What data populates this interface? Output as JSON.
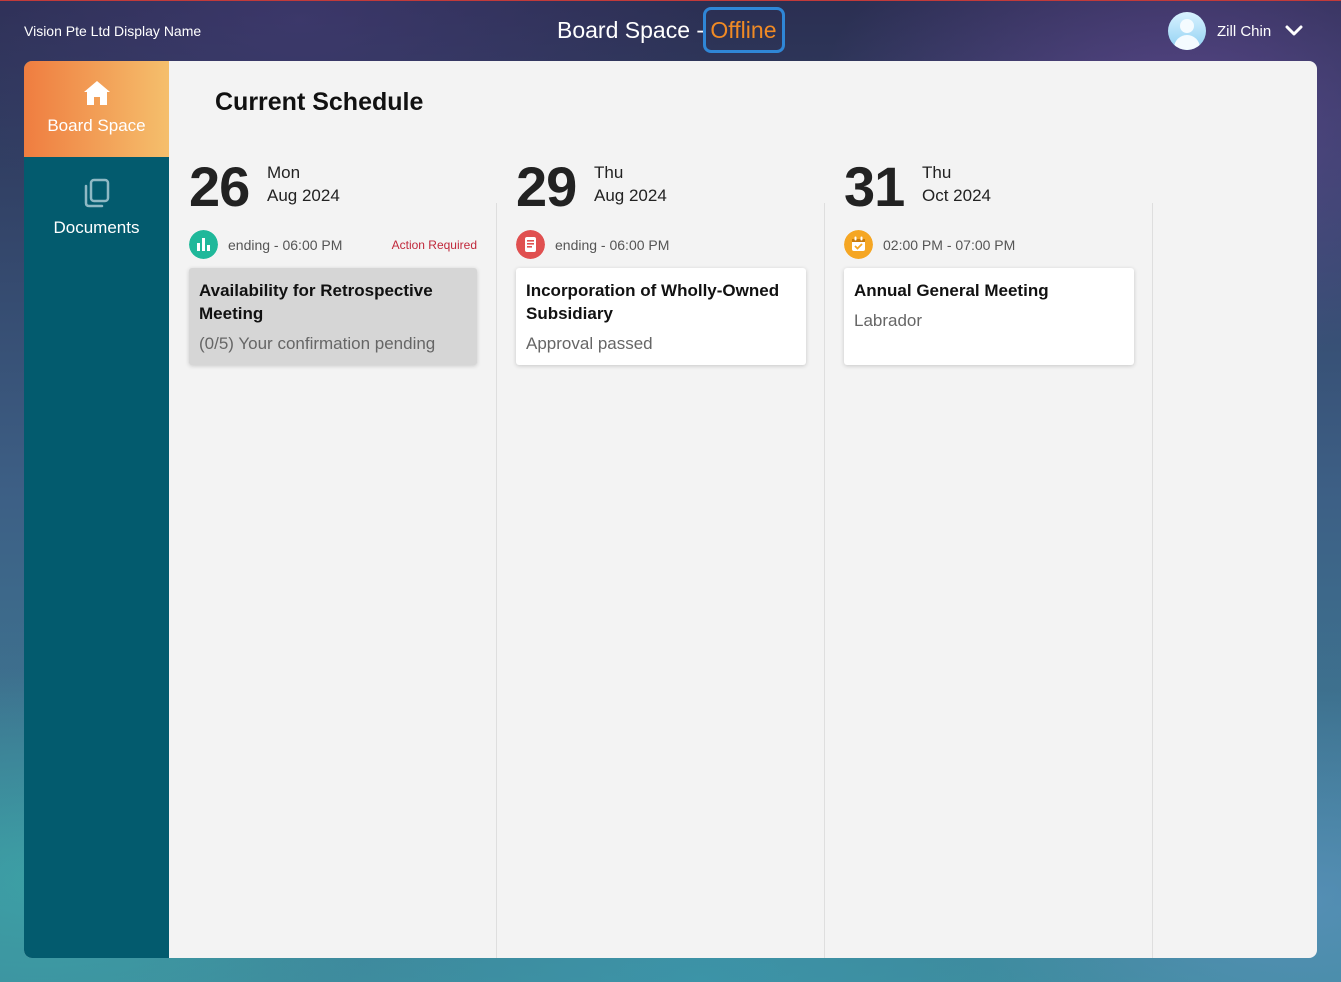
{
  "header": {
    "org_name": "Vision Pte Ltd Display Name",
    "title": "Board Space - ",
    "status": "Offline",
    "user_name": "Zill Chin"
  },
  "sidebar": {
    "items": [
      {
        "label": "Board Space",
        "icon": "home-icon",
        "active": true
      },
      {
        "label": "Documents",
        "icon": "documents-icon",
        "active": false
      }
    ]
  },
  "main": {
    "title": "Current Schedule",
    "columns": [
      {
        "day": "26",
        "weekday": "Mon",
        "month_year": "Aug 2024",
        "time": "ending - 06:00 PM",
        "badge": "Action Required",
        "icon": "poll-icon",
        "icon_color": "#1fb89a",
        "card_title": "Availability for Retrospective Meeting",
        "card_sub": "(0/5) Your confirmation pending"
      },
      {
        "day": "29",
        "weekday": "Thu",
        "month_year": "Aug 2024",
        "time": "ending - 06:00 PM",
        "badge": "",
        "icon": "document-icon",
        "icon_color": "#e05050",
        "card_title": "Incorporation of Wholly-Owned Subsidiary",
        "card_sub": "Approval passed"
      },
      {
        "day": "31",
        "weekday": "Thu",
        "month_year": "Oct 2024",
        "time": "02:00 PM - 07:00 PM",
        "badge": "",
        "icon": "calendar-icon",
        "icon_color": "#f5a623",
        "card_title": "Annual General Meeting",
        "card_sub": "Labrador"
      }
    ]
  },
  "colors": {
    "sidebar_bg": "#035b6e",
    "active_gradient_start": "#ef7d40",
    "active_gradient_end": "#f5bf6c",
    "offline": "#f08a24",
    "action_required": "#c0283b"
  }
}
